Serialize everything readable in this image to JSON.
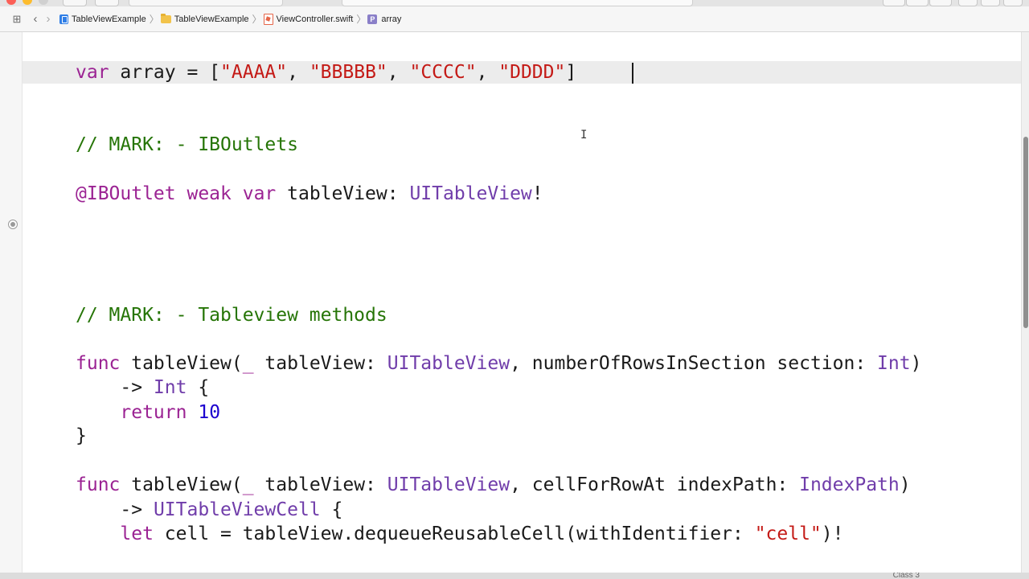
{
  "breadcrumb": {
    "items": [
      "TableViewExample",
      "TableViewExample",
      "ViewController.swift",
      "array"
    ],
    "symbol_letter": "P"
  },
  "code": {
    "array_decl": [
      "var",
      " array = [",
      "\"AAAA\"",
      ", ",
      "\"BBBBB\"",
      ", ",
      "\"CCCC\"",
      ", ",
      "\"DDDD\"",
      "]"
    ],
    "mark_outlets": "// MARK: - IBOutlets",
    "outlet": [
      "@IBOutlet",
      " ",
      "weak",
      " ",
      "var",
      " tableView: ",
      "UITableView",
      "!"
    ],
    "mark_methods": "// MARK: - Tableview methods",
    "func1_sig": [
      "func",
      " tableView(",
      "_",
      " tableView: ",
      "UITableView",
      ", numberOfRowsInSection section: ",
      "Int",
      ")"
    ],
    "func1_ret": [
      "    -> ",
      "Int",
      " {"
    ],
    "func1_body": [
      "    ",
      "return",
      " ",
      "10"
    ],
    "func1_close": "}",
    "func2_sig": [
      "func",
      " tableView(",
      "_",
      " tableView: ",
      "UITableView",
      ", cellForRowAt indexPath: ",
      "IndexPath",
      ")"
    ],
    "func2_ret": [
      "    -> ",
      "UITableViewCell",
      " {"
    ],
    "func2_body": [
      "    ",
      "let",
      " cell = tableView.dequeueReusableCell(withIdentifier: ",
      "\"cell\"",
      ")!"
    ]
  },
  "bottom": {
    "label": "Class 3"
  },
  "colors": {
    "keyword": "#9b2393",
    "type": "#703daa",
    "string": "#c41a16",
    "number": "#1c00cf",
    "comment": "#267507"
  }
}
